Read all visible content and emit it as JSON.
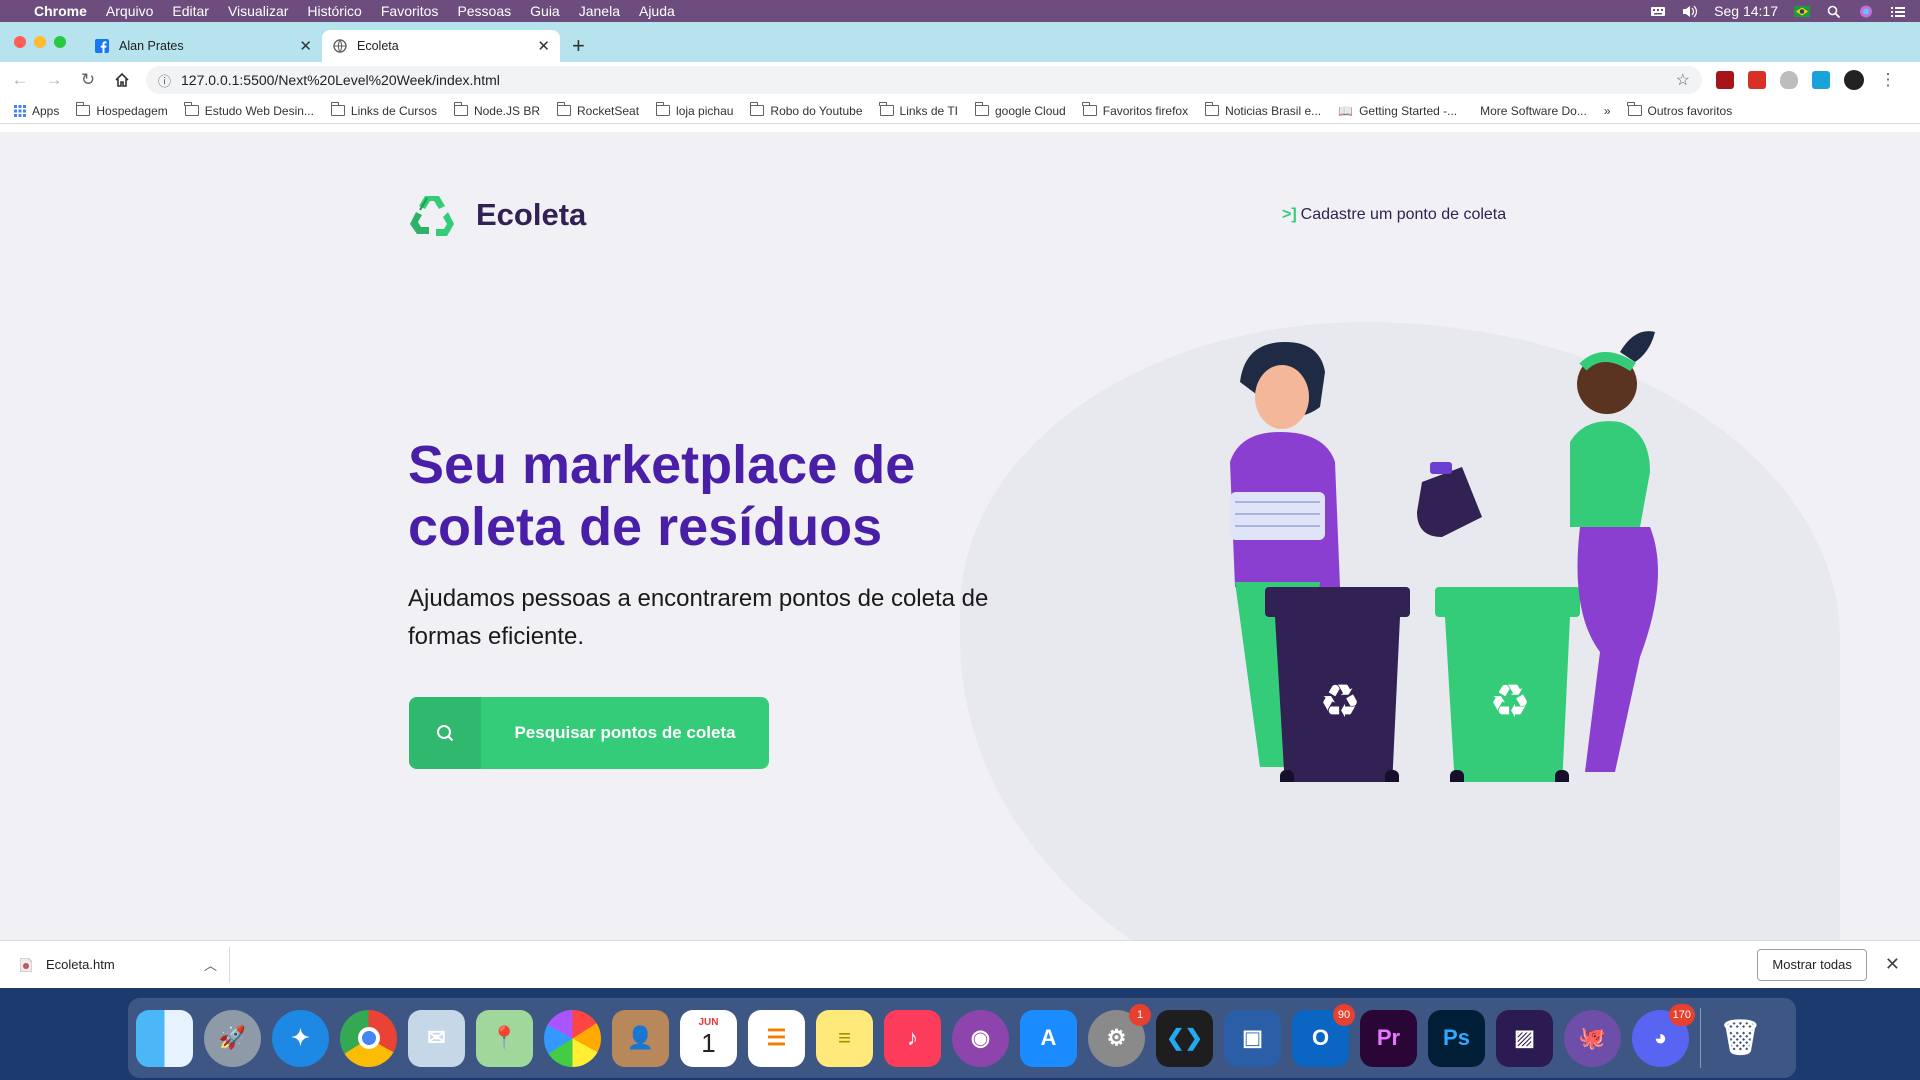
{
  "menubar": {
    "app_name": "Chrome",
    "items": [
      "Arquivo",
      "Editar",
      "Visualizar",
      "Histórico",
      "Favoritos",
      "Pessoas",
      "Guia",
      "Janela",
      "Ajuda"
    ],
    "clock": "Seg 14:17"
  },
  "tabs": [
    {
      "title": "Alan Prates",
      "icon": "facebook-icon"
    },
    {
      "title": "Ecoleta",
      "icon": "globe-icon"
    }
  ],
  "toolbar": {
    "url": "127.0.0.1:5500/Next%20Level%20Week/index.html"
  },
  "bookmarks": {
    "apps_label": "Apps",
    "items": [
      "Hospedagem",
      "Estudo Web Desin...",
      "Links de Cursos",
      "Node.JS BR",
      "RocketSeat",
      "loja pichau",
      "Robo do Youtube",
      "Links de TI",
      "google Cloud",
      "Favoritos firefox",
      "Noticias Brasil e...",
      "Getting Started -...",
      "More Software Do..."
    ],
    "overflow": "»",
    "other": "Outros favoritos"
  },
  "page": {
    "logo_text": "Ecoleta",
    "header_link": "Cadastre um ponto de coleta",
    "header_link_arrow": ">]",
    "hero_title": "Seu marketplace de coleta de resíduos",
    "hero_sub": "Ajudamos pessoas a encontrarem pontos de coleta de formas eficiente.",
    "cta_label": "Pesquisar pontos de coleta",
    "colors": {
      "primary": "#34cb79",
      "title": "#4a1fa8",
      "dark": "#322153",
      "background": "#f0f0f5"
    }
  },
  "downloads": {
    "file": "Ecoleta.htm",
    "show_all": "Mostrar todas"
  },
  "dock": {
    "calendar_month": "JUN",
    "calendar_day": "1",
    "badges": {
      "system_prefs": "1",
      "outlook": "90",
      "discord": "170"
    },
    "premiere_label": "Pr",
    "photoshop_label": "Ps"
  }
}
